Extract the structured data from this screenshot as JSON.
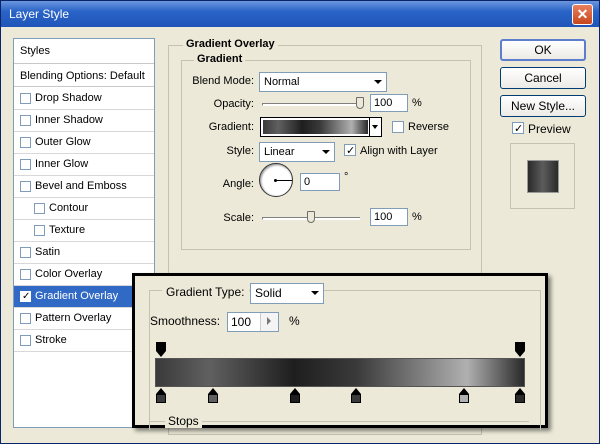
{
  "window": {
    "title": "Layer Style",
    "close_glyph": "✕"
  },
  "styles_list": {
    "header": "Styles",
    "blending": "Blending Options: Default",
    "items": [
      {
        "label": "Drop Shadow",
        "checked": false,
        "sub": false
      },
      {
        "label": "Inner Shadow",
        "checked": false,
        "sub": false
      },
      {
        "label": "Outer Glow",
        "checked": false,
        "sub": false
      },
      {
        "label": "Inner Glow",
        "checked": false,
        "sub": false
      },
      {
        "label": "Bevel and Emboss",
        "checked": false,
        "sub": false
      },
      {
        "label": "Contour",
        "checked": false,
        "sub": true
      },
      {
        "label": "Texture",
        "checked": false,
        "sub": true
      },
      {
        "label": "Satin",
        "checked": false,
        "sub": false
      },
      {
        "label": "Color Overlay",
        "checked": false,
        "sub": false
      },
      {
        "label": "Gradient Overlay",
        "checked": true,
        "sub": false,
        "selected": true
      },
      {
        "label": "Pattern Overlay",
        "checked": false,
        "sub": false
      },
      {
        "label": "Stroke",
        "checked": false,
        "sub": false
      }
    ]
  },
  "gradient_overlay": {
    "section_title": "Gradient Overlay",
    "subsection_title": "Gradient",
    "blend_mode_label": "Blend Mode:",
    "blend_mode_value": "Normal",
    "opacity_label": "Opacity:",
    "opacity_value": "100",
    "opacity_unit": "%",
    "opacity_level": 1.0,
    "gradient_label": "Gradient:",
    "reverse_label": "Reverse",
    "reverse_checked": false,
    "style_label": "Style:",
    "style_value": "Linear",
    "align_label": "Align with Layer",
    "align_checked": true,
    "angle_label": "Angle:",
    "angle_value": "0",
    "angle_unit": "°",
    "scale_label": "Scale:",
    "scale_value": "100",
    "scale_unit": "%",
    "scale_level": 0.5
  },
  "buttons": {
    "ok": "OK",
    "cancel": "Cancel",
    "new_style": "New Style..."
  },
  "preview": {
    "label": "Preview",
    "checked": true
  },
  "gradient_editor": {
    "type_label": "Gradient Type:",
    "type_value": "Solid",
    "smoothness_label": "Smoothness:",
    "smoothness_value": "100",
    "smoothness_unit": "%",
    "stops_label": "Stops",
    "opacity_stops": [
      0.0,
      1.0
    ],
    "color_stops": [
      {
        "pos": 0.0,
        "color": "#3a3a3a"
      },
      {
        "pos": 0.145,
        "color": "#606060"
      },
      {
        "pos": 0.375,
        "color": "#1e1e1e"
      },
      {
        "pos": 0.545,
        "color": "#3a3a3a"
      },
      {
        "pos": 0.845,
        "color": "#b0b0b0"
      },
      {
        "pos": 1.0,
        "color": "#2a2a2a"
      }
    ]
  },
  "colors": {
    "accent": "#316ac5",
    "title_bar": "#2a64c8",
    "close": "#c8461c"
  }
}
